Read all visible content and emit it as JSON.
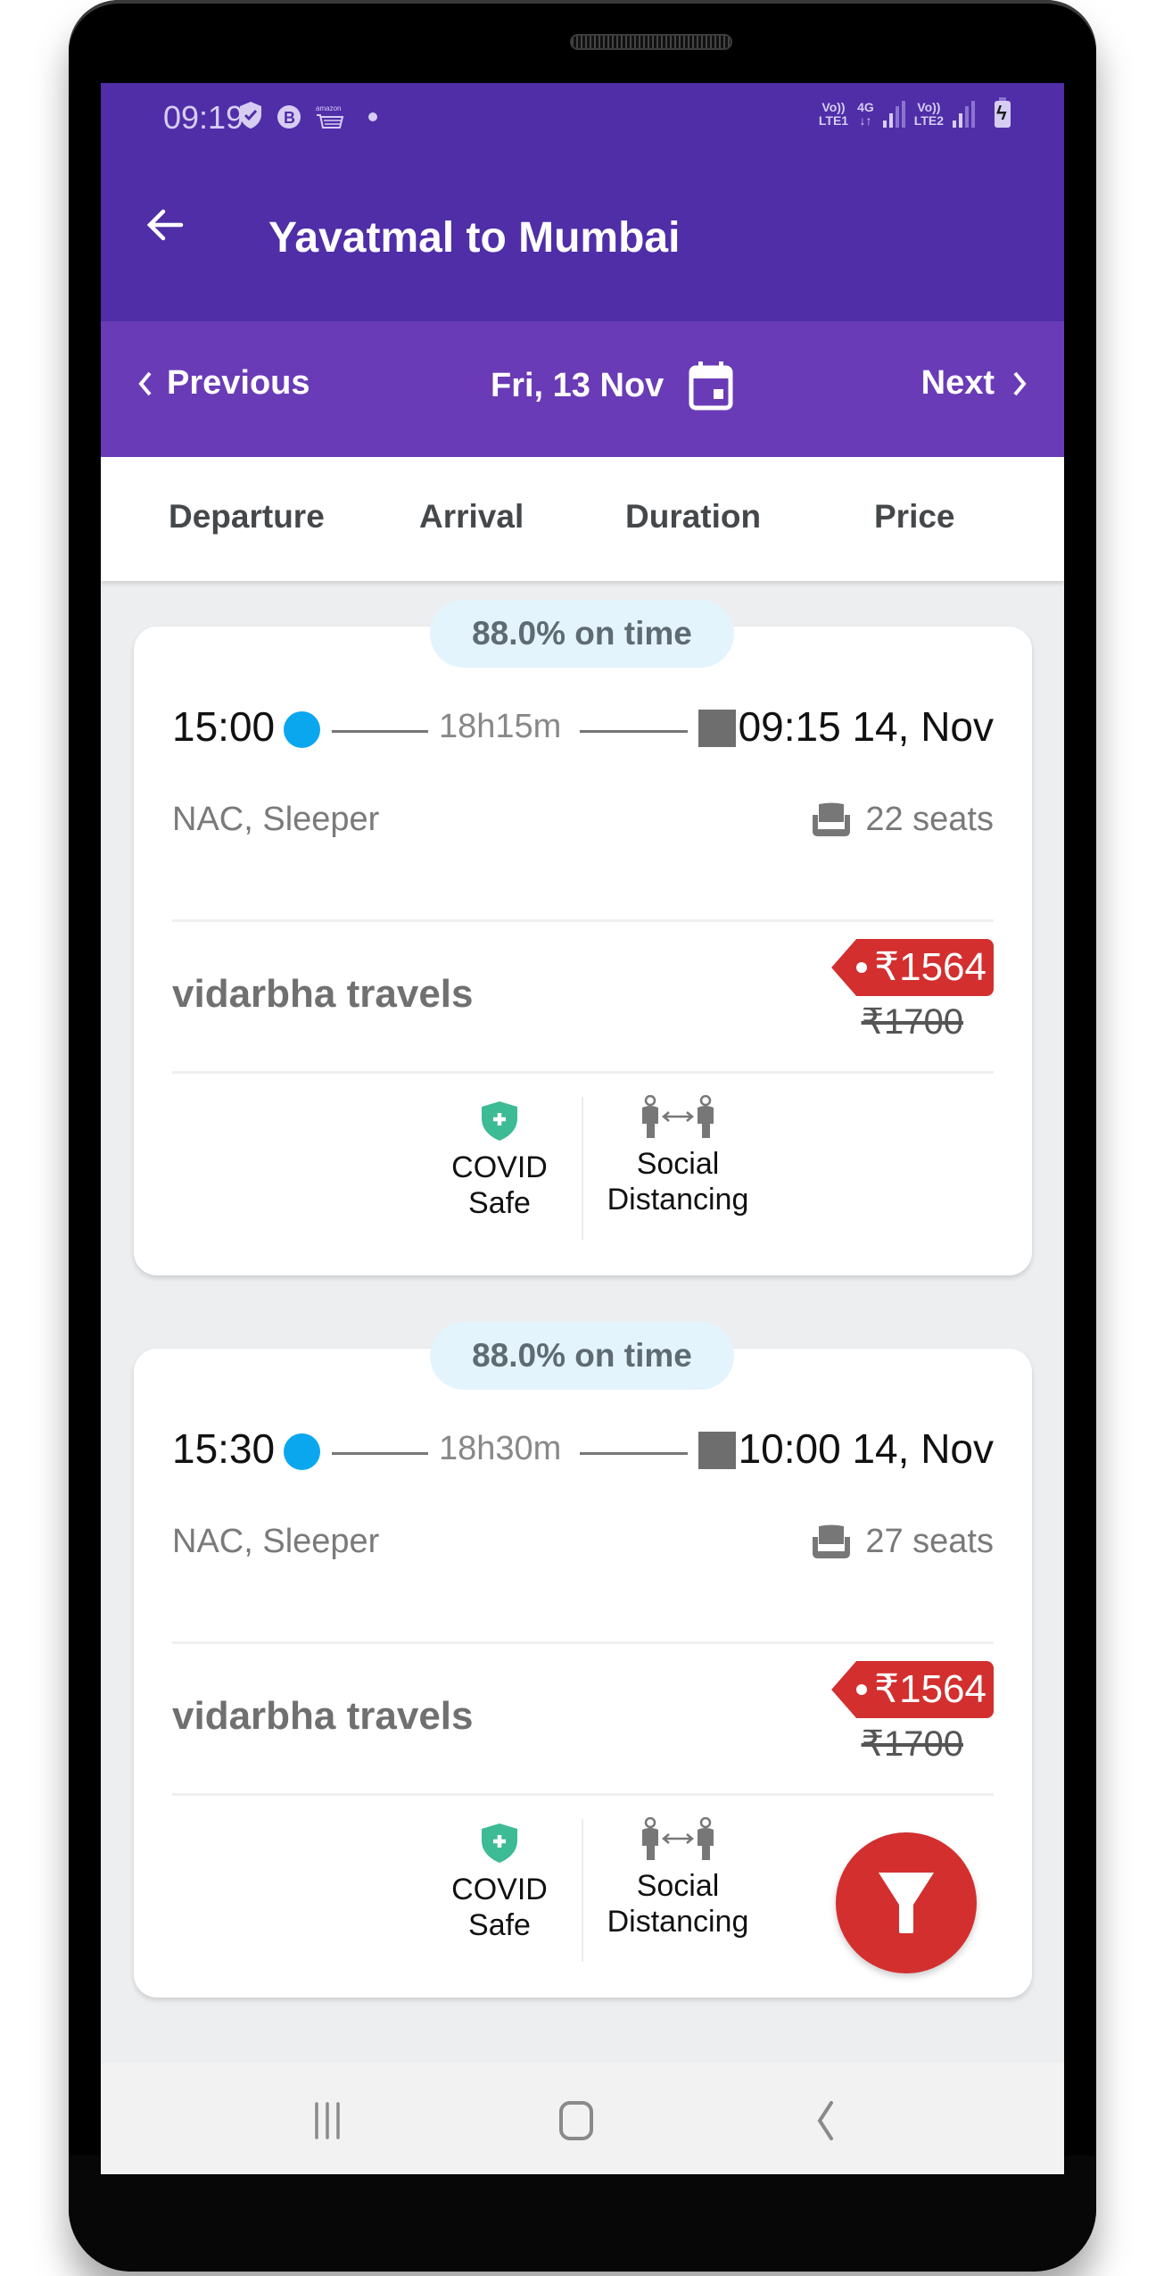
{
  "status_bar": {
    "time": "09:19",
    "icons": [
      "shield-check-icon",
      "b-app-icon",
      "amazon-cart-icon",
      "dot-icon"
    ],
    "sim1": {
      "top": "Vo))",
      "bottom": "LTE1"
    },
    "network": {
      "top": "4G",
      "bottom": "↓↑"
    },
    "sim2": {
      "top": "Vo))",
      "bottom": "LTE2"
    },
    "battery": "charging"
  },
  "app_bar": {
    "title": "Yavatmal to Mumbai",
    "back_icon": "arrow-left-icon"
  },
  "date_bar": {
    "previous_label": "Previous",
    "date_label": "Fri, 13 Nov",
    "next_label": "Next"
  },
  "sort_bar": {
    "options": [
      "Departure",
      "Arrival",
      "Duration",
      "Price"
    ]
  },
  "results": [
    {
      "on_time": "88.0% on time",
      "departure": "15:00",
      "duration": "18h15m",
      "arrival": "09:15 14, Nov",
      "bus_type": "NAC, Sleeper",
      "seats": "22 seats",
      "operator": "vidarbha travels",
      "price": "₹1564",
      "original_price": "₹1700",
      "amenities": [
        {
          "icon": "covid-shield-icon",
          "line1": "COVID",
          "line2": "Safe"
        },
        {
          "icon": "social-distancing-icon",
          "line1": "Social",
          "line2": "Distancing"
        }
      ]
    },
    {
      "on_time": "88.0% on time",
      "departure": "15:30",
      "duration": "18h30m",
      "arrival": "10:00 14, Nov",
      "bus_type": "NAC, Sleeper",
      "seats": "27 seats",
      "operator": "vidarbha travels",
      "price": "₹1564",
      "original_price": "₹1700",
      "amenities": [
        {
          "icon": "covid-shield-icon",
          "line1": "COVID",
          "line2": "Safe"
        },
        {
          "icon": "social-distancing-icon",
          "line1": "Social",
          "line2": "Distancing"
        }
      ]
    }
  ],
  "fab": {
    "icon": "filter-icon"
  },
  "colors": {
    "primary_dark": "#4f2ea8",
    "primary": "#6a3bb6",
    "accent_red": "#d32f2f",
    "departure_dot": "#0aa7ef",
    "on_time_bg": "#e3f4fc",
    "covid_green": "#3dbb94"
  },
  "nav_bar": {
    "buttons": [
      "recents-icon",
      "home-icon",
      "back-icon"
    ]
  }
}
